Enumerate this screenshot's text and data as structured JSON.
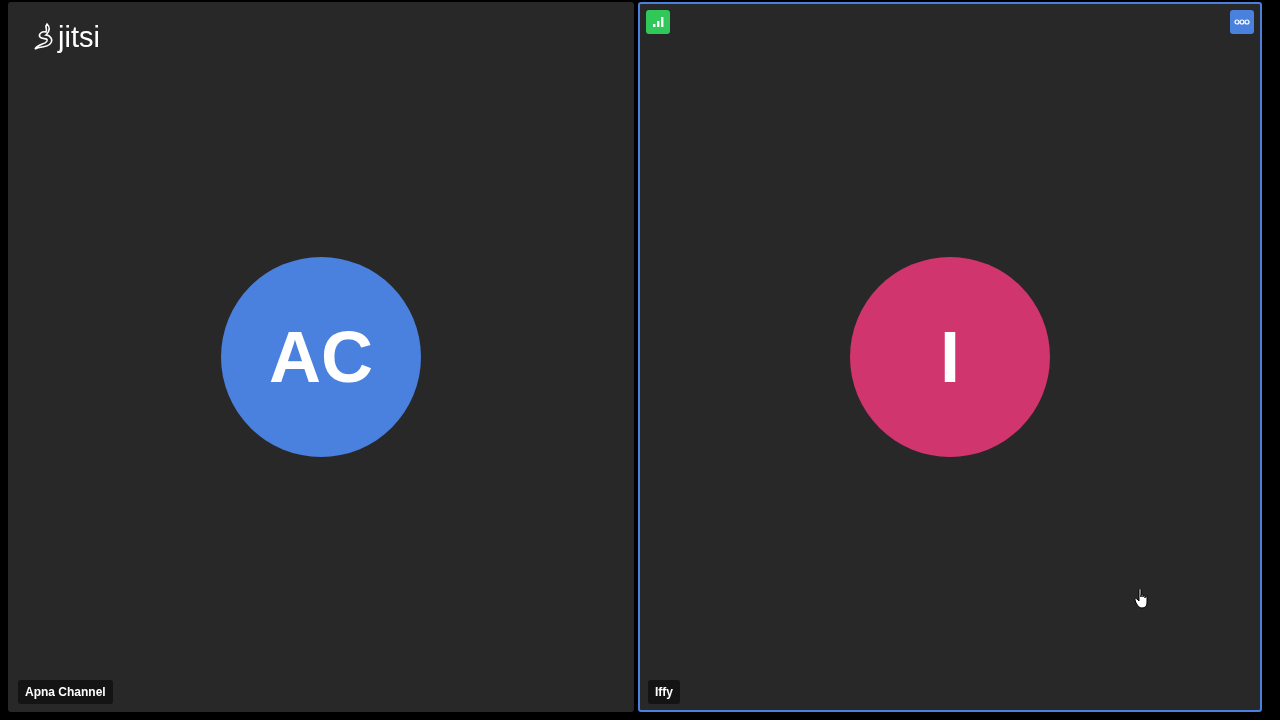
{
  "logo": {
    "text": "jitsi"
  },
  "tiles": [
    {
      "initials": "AC",
      "name": "Apna Channel",
      "color": "#4a80de",
      "selected": false,
      "hovered": false
    },
    {
      "initials": "I",
      "name": "Iffy",
      "color": "#d1356e",
      "selected": true,
      "hovered": true
    }
  ]
}
